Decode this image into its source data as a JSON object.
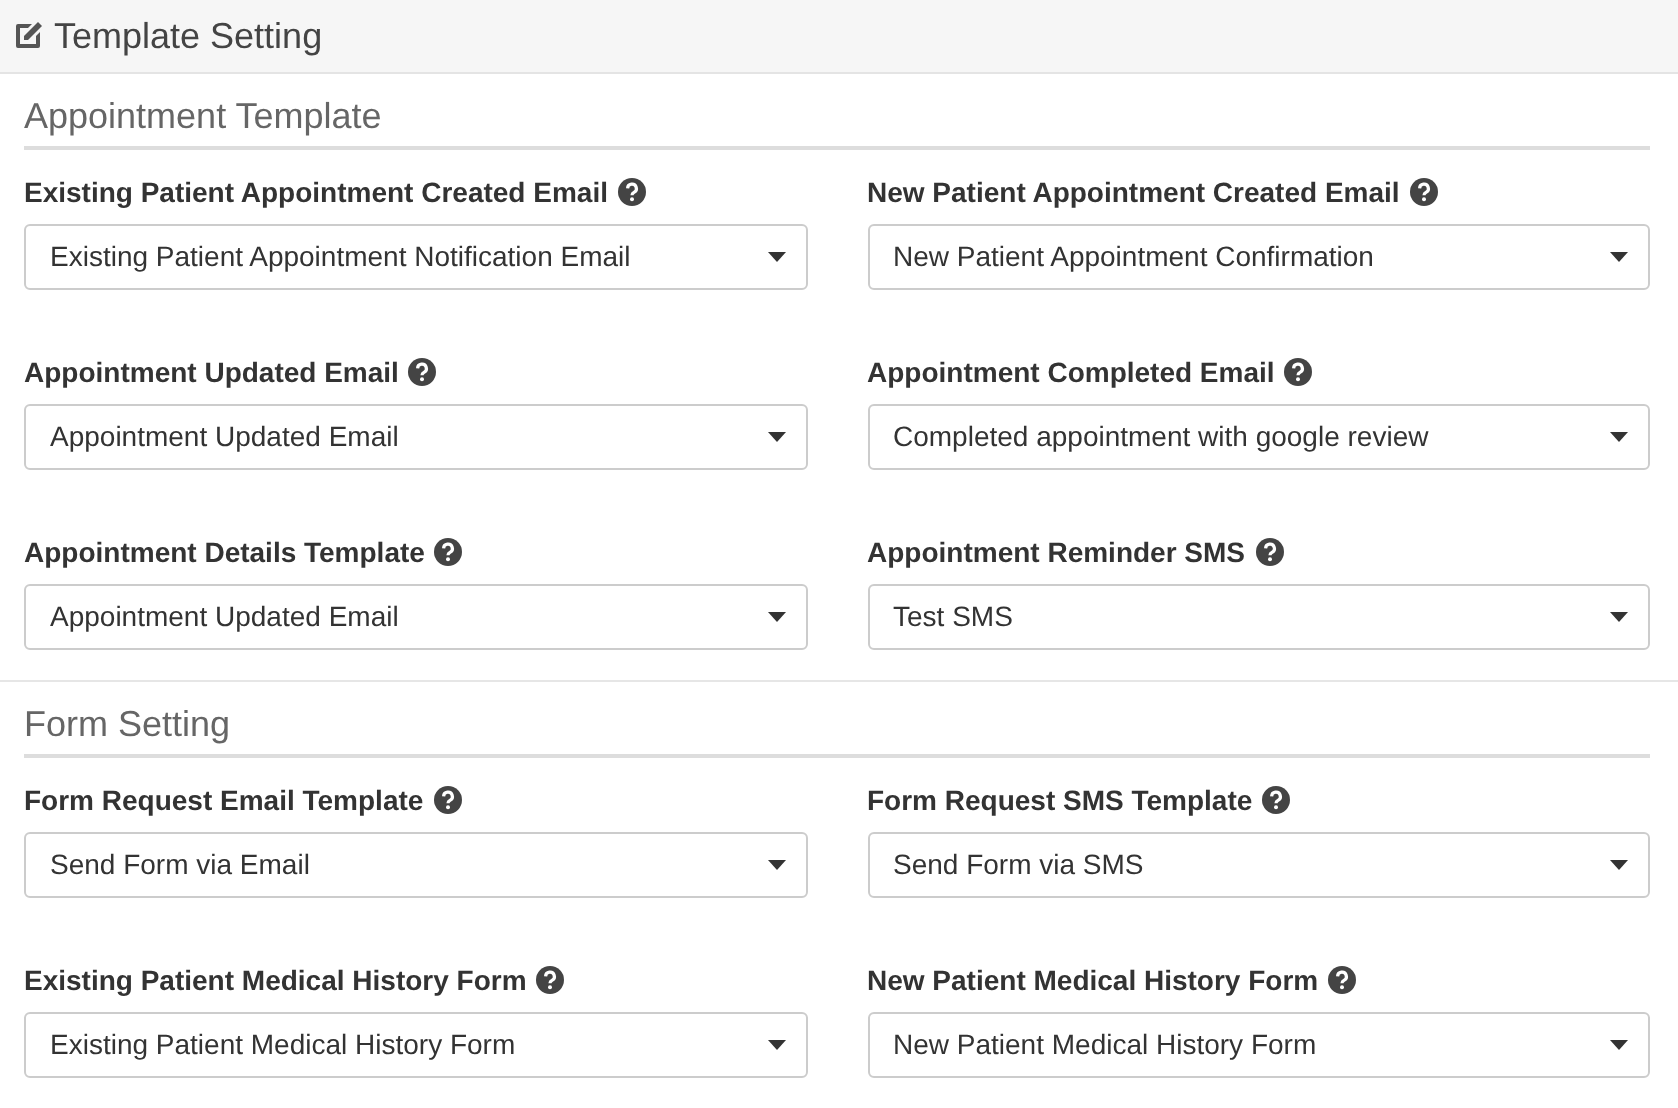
{
  "header": {
    "title": "Template Setting"
  },
  "sections": [
    {
      "title": "Appointment Template",
      "fields": [
        {
          "label": "Existing Patient Appointment Created Email",
          "value": "Existing Patient Appointment Notification Email"
        },
        {
          "label": "New Patient Appointment Created Email",
          "value": "New Patient Appointment Confirmation"
        },
        {
          "label": "Appointment Updated Email",
          "value": "Appointment Updated Email"
        },
        {
          "label": "Appointment Completed Email",
          "value": "Completed appointment with google review"
        },
        {
          "label": "Appointment Details Template",
          "value": "Appointment Updated Email"
        },
        {
          "label": "Appointment Reminder SMS",
          "value": "Test SMS"
        }
      ]
    },
    {
      "title": "Form Setting",
      "fields": [
        {
          "label": "Form Request Email Template",
          "value": "Send Form via Email"
        },
        {
          "label": "Form Request SMS Template",
          "value": "Send Form via SMS"
        },
        {
          "label": "Existing Patient Medical History Form",
          "value": "Existing Patient Medical History Form"
        },
        {
          "label": "New Patient Medical History Form",
          "value": "New Patient Medical History Form"
        }
      ]
    }
  ]
}
